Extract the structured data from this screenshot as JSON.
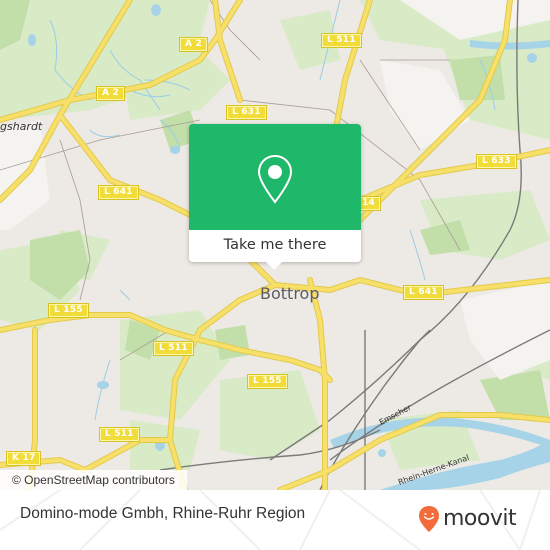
{
  "map": {
    "place_labels": {
      "city": "Bottrop",
      "partial_west": "gshardt"
    },
    "road_shields": {
      "a2_north": "A 2",
      "a2_west": "A 2",
      "l511_north": "L 511",
      "l631": "L 631",
      "l633": "L 633",
      "l641_west": "L 641",
      "l641_east": "L 641",
      "b14_partial": "14",
      "l155_west": "L 155",
      "l155_center": "L 155",
      "l511_center": "L 511",
      "l511_south": "L 511",
      "k17": "K 17"
    },
    "water_labels": {
      "canal_1": "Emscher",
      "canal_2": "Rhein-Herne-Kanal"
    },
    "attribution": "© OpenStreetMap contributors",
    "colors": {
      "land": "#ede9e4",
      "park": "#d4e8c0",
      "forest": "#b9d9a0",
      "water": "#a6d3e8",
      "road_major": "#f5dd5e",
      "rail": "#777777"
    }
  },
  "popup": {
    "action_label": "Take me there",
    "icon": "map-pin-icon",
    "color": "#1fb86a"
  },
  "footer": {
    "title": "Domino-mode Gmbh, Rhine-Ruhr Region",
    "brand": "moovit",
    "brand_color": "#f26b3a"
  }
}
